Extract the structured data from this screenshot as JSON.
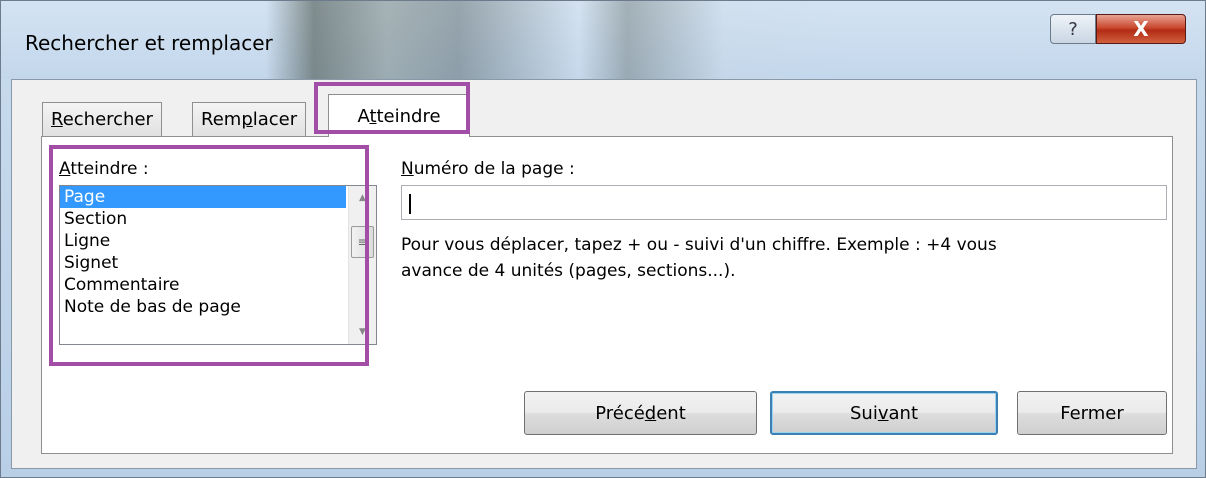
{
  "window": {
    "title": "Rechercher et remplacer",
    "help_glyph": "?",
    "close_glyph": "X"
  },
  "tabs": [
    {
      "label": "Rechercher",
      "mnemonic": "R",
      "active": false
    },
    {
      "label": "Remplacer",
      "mnemonic": "p",
      "active": false
    },
    {
      "label": "Atteindre",
      "mnemonic": "t",
      "active": true
    }
  ],
  "goto": {
    "list_label": "Atteindre :",
    "items": [
      "Page",
      "Section",
      "Ligne",
      "Signet",
      "Commentaire",
      "Note de bas de page"
    ],
    "selected": "Page",
    "field_label": "Numéro de la page :",
    "field_value": "",
    "hint_line1": "Pour vous déplacer, tapez + ou - suivi d'un chiffre. Exemple : +4 vous",
    "hint_line2": "avance de 4 unités (pages, sections...)."
  },
  "buttons": {
    "previous": "Précédent",
    "next": "Suivant",
    "close": "Fermer"
  },
  "colors": {
    "highlight": "#a24ea6",
    "selection": "#3399ff",
    "close_button": "#c9492f"
  }
}
